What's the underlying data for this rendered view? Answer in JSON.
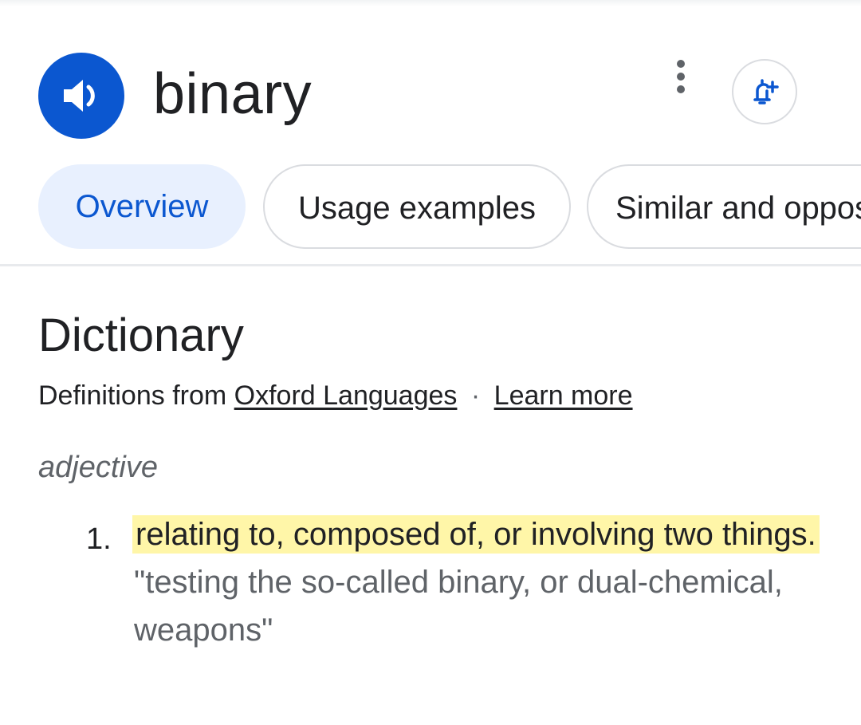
{
  "header": {
    "word": "binary",
    "speaker_icon": "speaker-icon",
    "more_icon": "more-vert-icon",
    "alert_icon": "add-alert-icon"
  },
  "tabs": [
    {
      "label": "Overview",
      "active": true
    },
    {
      "label": "Usage examples",
      "active": false
    },
    {
      "label": "Similar and opposite words",
      "active": false
    }
  ],
  "dictionary": {
    "title": "Dictionary",
    "source_prefix": "Definitions from",
    "source_link": "Oxford Languages",
    "separator": "·",
    "learn_more": "Learn more",
    "part_of_speech": "adjective",
    "definitions": [
      {
        "number": "1.",
        "text": "relating to, composed of, or involving two things.",
        "example": "\"testing the so-called binary, or dual-chemical, weapons\""
      }
    ]
  },
  "colors": {
    "accent": "#0b57d0",
    "active_tab_bg": "#e8f0fe",
    "highlight": "#fff6a8",
    "muted_text": "#5f6368"
  }
}
